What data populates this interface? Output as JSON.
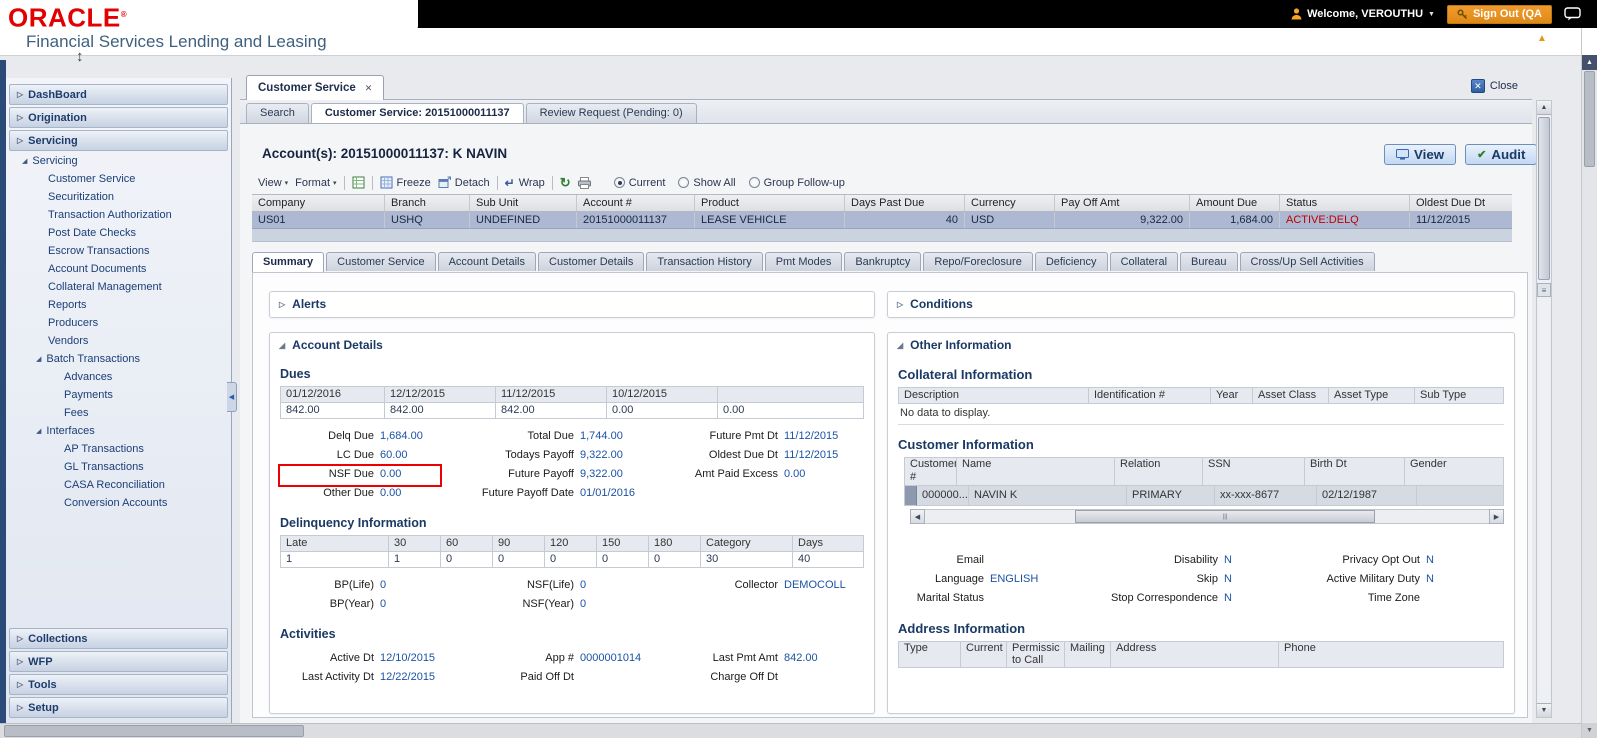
{
  "colors": {
    "oracle_red": "#e20000",
    "signout_orange": "#f09a2e",
    "value_blue": "#1b52a5",
    "status_red": "#c00000",
    "selected_row": "#adb9d2",
    "heading_navy": "#1a3964",
    "nsf_highlight": "#ee0000"
  },
  "icons": {
    "close_x": "✕",
    "dropdown_caret": "▾",
    "welcome_caret": "▼",
    "refresh": "↻",
    "wrap": "↵",
    "audit_check": "✔",
    "collapse_up": "▲",
    "scroll_up": "▲",
    "scroll_down": "▼",
    "scroll_left": "◀",
    "scroll_right": "▶",
    "splitter": "≡",
    "resize": "↕",
    "sidebar_collapse": "◀",
    "thumb_grip": "|||"
  },
  "brand": {
    "logo": "ORACLE",
    "registered": "®",
    "subtitle": "Financial Services Lending and Leasing"
  },
  "topbar": {
    "welcome": "Welcome, VEROUTHU",
    "signout": "Sign Out (QA"
  },
  "sidebar": {
    "items": [
      {
        "label": "DashBoard",
        "type": "section",
        "arrow": "▷"
      },
      {
        "label": "Origination",
        "type": "section",
        "arrow": "▷"
      },
      {
        "label": "Servicing",
        "type": "section",
        "arrow": "▷",
        "active": true
      },
      {
        "label": "Servicing",
        "type": "node0",
        "arrow": "◢"
      },
      {
        "label": "Customer Service",
        "type": "leaf1"
      },
      {
        "label": "Securitization",
        "type": "leaf1"
      },
      {
        "label": "Transaction Authorization",
        "type": "leaf1"
      },
      {
        "label": "Post Date Checks",
        "type": "leaf1"
      },
      {
        "label": "Escrow Transactions",
        "type": "leaf1"
      },
      {
        "label": "Account Documents",
        "type": "leaf1"
      },
      {
        "label": "Collateral Management",
        "type": "leaf1"
      },
      {
        "label": "Reports",
        "type": "leaf1"
      },
      {
        "label": "Producers",
        "type": "leaf1"
      },
      {
        "label": "Vendors",
        "type": "leaf1"
      },
      {
        "label": "Batch Transactions",
        "type": "node1",
        "arrow": "◢"
      },
      {
        "label": "Advances",
        "type": "leaf2"
      },
      {
        "label": "Payments",
        "type": "leaf2"
      },
      {
        "label": "Fees",
        "type": "leaf2"
      },
      {
        "label": "Interfaces",
        "type": "node1",
        "arrow": "◢"
      },
      {
        "label": "AP Transactions",
        "type": "leaf2"
      },
      {
        "label": "GL Transactions",
        "type": "leaf2"
      },
      {
        "label": "CASA Reconciliation",
        "type": "leaf2"
      },
      {
        "label": "Conversion Accounts",
        "type": "leaf2"
      },
      {
        "type": "spacer"
      },
      {
        "label": "Collections",
        "type": "section",
        "arrow": "▷"
      },
      {
        "label": "WFP",
        "type": "section",
        "arrow": "▷"
      },
      {
        "label": "Tools",
        "type": "section",
        "arrow": "▷"
      },
      {
        "label": "Setup",
        "type": "section",
        "arrow": "▷"
      }
    ]
  },
  "doc_tab": {
    "label": "Customer Service"
  },
  "close_button": {
    "label": "Close"
  },
  "subtabs": [
    {
      "label": "Search"
    },
    {
      "label": "Customer Service: 20151000011137",
      "active": true
    },
    {
      "label": "Review Request (Pending: 0)"
    }
  ],
  "account_header": {
    "title": "Account(s): 20151000011137: K NAVIN",
    "view_button": "View",
    "audit_button": "Audit"
  },
  "toolbar": {
    "view": "View",
    "format": "Format",
    "freeze": "Freeze",
    "detach": "Detach",
    "wrap": "Wrap",
    "radios": [
      {
        "label": "Current",
        "active": true
      },
      {
        "label": "Show All"
      },
      {
        "label": "Group Follow-up"
      }
    ]
  },
  "account_grid": {
    "headers": [
      "Company",
      "Branch",
      "Sub Unit",
      "Account #",
      "Product",
      "Days Past Due",
      "Currency",
      "Pay Off Amt",
      "Amount Due",
      "Status",
      "Oldest Due Dt"
    ],
    "row": [
      "US01",
      "USHQ",
      "UNDEFINED",
      "20151000011137",
      "LEASE VEHICLE",
      "40",
      "USD",
      "9,322.00",
      "1,684.00",
      "ACTIVE:DELQ",
      "11/12/2015"
    ]
  },
  "tabs": [
    {
      "label": "Summary",
      "active": true
    },
    {
      "label": "Customer Service"
    },
    {
      "label": "Account Details"
    },
    {
      "label": "Customer Details"
    },
    {
      "label": "Transaction History"
    },
    {
      "label": "Pmt Modes"
    },
    {
      "label": "Bankruptcy"
    },
    {
      "label": "Repo/Foreclosure"
    },
    {
      "label": "Deficiency"
    },
    {
      "label": "Collateral"
    },
    {
      "label": "Bureau"
    },
    {
      "label": "Cross/Up Sell Activities"
    }
  ],
  "alerts_panel": {
    "title": "Alerts",
    "arrow": "▷"
  },
  "conditions_panel": {
    "title": "Conditions",
    "arrow": "▷"
  },
  "account_details": {
    "title": "Account Details",
    "arrow": "◢",
    "dues": {
      "title": "Dues",
      "headers": [
        "01/12/2016",
        "12/12/2015",
        "11/12/2015",
        "10/12/2015",
        ""
      ],
      "row": [
        "842.00",
        "842.00",
        "842.00",
        "0.00",
        "0.00"
      ],
      "col1": [
        {
          "label": "Delq Due",
          "value": "1,684.00"
        },
        {
          "label": "LC Due",
          "value": "60.00"
        },
        {
          "label": "NSF Due",
          "value": "0.00",
          "cls": "nsf-box"
        },
        {
          "label": "Other Due",
          "value": "0.00"
        }
      ],
      "col2": [
        {
          "label": "Total Due",
          "value": "1,744.00"
        },
        {
          "label": "Todays Payoff",
          "value": "9,322.00"
        },
        {
          "label": "Future Payoff",
          "value": "9,322.00"
        },
        {
          "label": "Future Payoff Date",
          "value": "01/01/2016"
        }
      ],
      "col3": [
        {
          "label": "Future Pmt Dt",
          "value": "11/12/2015"
        },
        {
          "label": "Oldest Due Dt",
          "value": "11/12/2015"
        },
        {
          "label": "Amt Paid Excess",
          "value": "0.00"
        }
      ]
    },
    "delinquency": {
      "title": "Delinquency Information",
      "headers": [
        "Late",
        "30",
        "60",
        "90",
        "120",
        "150",
        "180",
        "Category",
        "Days"
      ],
      "row": [
        "1",
        "1",
        "0",
        "0",
        "0",
        "0",
        "0",
        "30",
        "40"
      ],
      "col1": [
        {
          "label": "BP(Life)",
          "value": "0"
        },
        {
          "label": "BP(Year)",
          "value": "0"
        }
      ],
      "col2": [
        {
          "label": "NSF(Life)",
          "value": "0"
        },
        {
          "label": "NSF(Year)",
          "value": "0"
        }
      ],
      "col3": [
        {
          "label": "Collector",
          "value": "DEMOCOLL"
        }
      ]
    },
    "activities": {
      "title": "Activities",
      "col1": [
        {
          "label": "Active Dt",
          "value": "12/10/2015"
        },
        {
          "label": "Last Activity Dt",
          "value": "12/22/2015"
        }
      ],
      "col2": [
        {
          "label": "App #",
          "value": "0000001014"
        },
        {
          "label": "Paid Off Dt",
          "value": ""
        }
      ],
      "col3": [
        {
          "label": "Last Pmt Amt",
          "value": "842.00"
        },
        {
          "label": "Charge Off Dt",
          "value": ""
        }
      ]
    }
  },
  "other_information": {
    "title": "Other Information",
    "arrow": "◢",
    "collateral": {
      "title": "Collateral Information",
      "headers": [
        "Description",
        "Identification #",
        "Year",
        "Asset Class",
        "Asset Type",
        "Sub Type"
      ],
      "empty": "No data to display."
    },
    "customer": {
      "title": "Customer Information",
      "headers": [
        "Customer #",
        "Name",
        "Relation",
        "SSN",
        "Birth Dt",
        "Gender"
      ],
      "row": [
        "000000...",
        "NAVIN K",
        "PRIMARY",
        "xx-xxx-8677",
        "02/12/1987",
        ""
      ],
      "col1": [
        {
          "label": "Email",
          "value": ""
        },
        {
          "label": "Language",
          "value": "ENGLISH"
        },
        {
          "label": "Marital Status",
          "value": ""
        }
      ],
      "col2": [
        {
          "label": "Disability",
          "value": "N"
        },
        {
          "label": "Skip",
          "value": "N"
        },
        {
          "label": "Stop Correspondence",
          "value": "N"
        }
      ],
      "col3": [
        {
          "label": "Privacy Opt Out",
          "value": "N"
        },
        {
          "label": "Active Military Duty",
          "value": "N"
        },
        {
          "label": "Time Zone",
          "value": ""
        }
      ]
    },
    "address": {
      "title": "Address Information",
      "headers": [
        "Type",
        "Current",
        "Permissic to Call",
        "Mailing",
        "Address",
        "Phone"
      ]
    }
  }
}
